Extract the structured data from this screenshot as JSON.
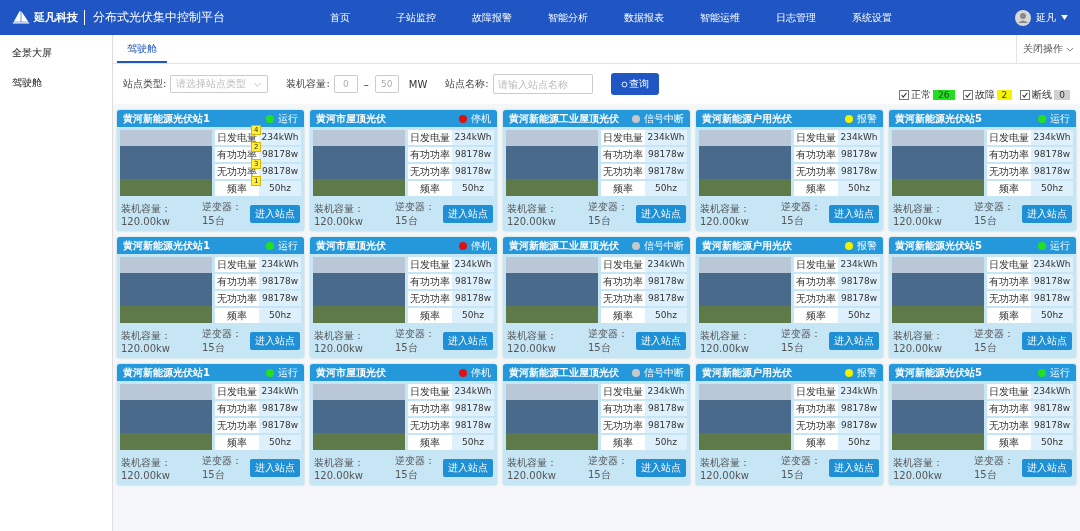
{
  "header": {
    "logo": "延凡科技",
    "title": "分布式光伏集中控制平台",
    "nav": [
      "首页",
      "子站监控",
      "故障报警",
      "智能分析",
      "数据报表",
      "智能运维",
      "日志管理",
      "系统设置"
    ],
    "user": "延凡"
  },
  "sidebar": {
    "items": [
      "全景大屏",
      "驾驶舱"
    ]
  },
  "tabs": [
    {
      "label": "驾驶舱",
      "selected": true
    }
  ],
  "close_action": "关闭操作",
  "filters": {
    "type_label": "站点类型:",
    "type_placeholder": "请选择站点类型",
    "capacity_label": "装机容量:",
    "capacity_min": "0",
    "range_sep": "–",
    "capacity_max": "50",
    "unit": "MW",
    "name_label": "站点名称:",
    "name_placeholder": "请输入站点名称",
    "query": "查询"
  },
  "legend": [
    {
      "label": "正常",
      "count": "26",
      "checked": true,
      "color": "#22e01f"
    },
    {
      "label": "故障",
      "count": "2",
      "checked": true,
      "color": "#f5f500"
    },
    {
      "label": "断线",
      "count": "0",
      "checked": true,
      "color": "#d0d0d0"
    }
  ],
  "rows": [
    {
      "cards": [
        {
          "name": "黄河新能源光伏站1",
          "status": "运行",
          "color": "#22e01f",
          "metrics": [
            {
              "label": "日发电量",
              "value": "234kWh",
              "badge": "4"
            },
            {
              "label": "有功功率",
              "value": "98178w",
              "badge": "2"
            },
            {
              "label": "无功功率",
              "value": "98178w",
              "badge": "3"
            },
            {
              "label": "频率",
              "value": "50hz",
              "badge": "1"
            }
          ],
          "capacity": "装机容量：120.00kw",
          "inverter": "逆变器：15台",
          "button": "进入站点"
        },
        {
          "name": "黄河市屋顶光伏",
          "status": "停机",
          "color": "#e01010",
          "metrics": [
            {
              "label": "日发电量",
              "value": "234kWh"
            },
            {
              "label": "有功功率",
              "value": "98178w"
            },
            {
              "label": "无功功率",
              "value": "98178w"
            },
            {
              "label": "频率",
              "value": "50hz"
            }
          ],
          "capacity": "装机容量：120.00kw",
          "inverter": "逆变器：15台",
          "button": "进入站点"
        },
        {
          "name": "黄河新能源工业屋顶光伏",
          "status": "信号中断",
          "color": "#c8c8c8",
          "metrics": [
            {
              "label": "日发电量",
              "value": "234kWh"
            },
            {
              "label": "有功功率",
              "value": "98178w"
            },
            {
              "label": "无功功率",
              "value": "98178w"
            },
            {
              "label": "频率",
              "value": "50hz"
            }
          ],
          "capacity": "装机容量：120.00kw",
          "inverter": "逆变器：15台",
          "button": "进入站点"
        },
        {
          "name": "黄河新能源户用光伏",
          "status": "报警",
          "color": "#f0f000",
          "metrics": [
            {
              "label": "日发电量",
              "value": "234kWh"
            },
            {
              "label": "有功功率",
              "value": "98178w"
            },
            {
              "label": "无功功率",
              "value": "98178w"
            },
            {
              "label": "频率",
              "value": "50hz"
            }
          ],
          "capacity": "装机容量：120.00kw",
          "inverter": "逆变器：15台",
          "button": "进入站点"
        },
        {
          "name": "黄河新能源光伏站5",
          "status": "运行",
          "color": "#22e01f",
          "metrics": [
            {
              "label": "日发电量",
              "value": "234kWh"
            },
            {
              "label": "有功功率",
              "value": "98178w"
            },
            {
              "label": "无功功率",
              "value": "98178w"
            },
            {
              "label": "频率",
              "value": "50hz"
            }
          ],
          "capacity": "装机容量：120.00kw",
          "inverter": "逆变器：15台",
          "button": "进入站点"
        }
      ]
    },
    {
      "cards": [
        {
          "name": "黄河新能源光伏站1",
          "status": "运行",
          "color": "#22e01f",
          "metrics": [
            {
              "label": "日发电量",
              "value": "234kWh"
            },
            {
              "label": "有功功率",
              "value": "98178w"
            },
            {
              "label": "无功功率",
              "value": "98178w"
            },
            {
              "label": "频率",
              "value": "50hz"
            }
          ],
          "capacity": "装机容量：120.00kw",
          "inverter": "逆变器：15台",
          "button": "进入站点"
        },
        {
          "name": "黄河市屋顶光伏",
          "status": "停机",
          "color": "#e01010",
          "metrics": [
            {
              "label": "日发电量",
              "value": "234kWh"
            },
            {
              "label": "有功功率",
              "value": "98178w"
            },
            {
              "label": "无功功率",
              "value": "98178w"
            },
            {
              "label": "频率",
              "value": "50hz"
            }
          ],
          "capacity": "装机容量：120.00kw",
          "inverter": "逆变器：15台",
          "button": "进入站点"
        },
        {
          "name": "黄河新能源工业屋顶光伏",
          "status": "信号中断",
          "color": "#c8c8c8",
          "metrics": [
            {
              "label": "日发电量",
              "value": "234kWh"
            },
            {
              "label": "有功功率",
              "value": "98178w"
            },
            {
              "label": "无功功率",
              "value": "98178w"
            },
            {
              "label": "频率",
              "value": "50hz"
            }
          ],
          "capacity": "装机容量：120.00kw",
          "inverter": "逆变器：15台",
          "button": "进入站点"
        },
        {
          "name": "黄河新能源户用光伏",
          "status": "报警",
          "color": "#f0f000",
          "metrics": [
            {
              "label": "日发电量",
              "value": "234kWh"
            },
            {
              "label": "有功功率",
              "value": "98178w"
            },
            {
              "label": "无功功率",
              "value": "98178w"
            },
            {
              "label": "频率",
              "value": "50hz"
            }
          ],
          "capacity": "装机容量：120.00kw",
          "inverter": "逆变器：15台",
          "button": "进入站点"
        },
        {
          "name": "黄河新能源光伏站5",
          "status": "运行",
          "color": "#22e01f",
          "metrics": [
            {
              "label": "日发电量",
              "value": "234kWh"
            },
            {
              "label": "有功功率",
              "value": "98178w"
            },
            {
              "label": "无功功率",
              "value": "98178w"
            },
            {
              "label": "频率",
              "value": "50hz"
            }
          ],
          "capacity": "装机容量：120.00kw",
          "inverter": "逆变器：15台",
          "button": "进入站点"
        }
      ]
    },
    {
      "cards": [
        {
          "name": "黄河新能源光伏站1",
          "status": "运行",
          "color": "#22e01f",
          "metrics": [
            {
              "label": "日发电量",
              "value": "234kWh"
            },
            {
              "label": "有功功率",
              "value": "98178w"
            },
            {
              "label": "无功功率",
              "value": "98178w"
            },
            {
              "label": "频率",
              "value": "50hz"
            }
          ],
          "capacity": "装机容量：120.00kw",
          "inverter": "逆变器：15台",
          "button": "进入站点"
        },
        {
          "name": "黄河市屋顶光伏",
          "status": "停机",
          "color": "#e01010",
          "metrics": [
            {
              "label": "日发电量",
              "value": "234kWh"
            },
            {
              "label": "有功功率",
              "value": "98178w"
            },
            {
              "label": "无功功率",
              "value": "98178w"
            },
            {
              "label": "频率",
              "value": "50hz"
            }
          ],
          "capacity": "装机容量：120.00kw",
          "inverter": "逆变器：15台",
          "button": "进入站点"
        },
        {
          "name": "黄河新能源工业屋顶光伏",
          "status": "信号中断",
          "color": "#c8c8c8",
          "metrics": [
            {
              "label": "日发电量",
              "value": "234kWh"
            },
            {
              "label": "有功功率",
              "value": "98178w"
            },
            {
              "label": "无功功率",
              "value": "98178w"
            },
            {
              "label": "频率",
              "value": "50hz"
            }
          ],
          "capacity": "装机容量：120.00kw",
          "inverter": "逆变器：15台",
          "button": "进入站点"
        },
        {
          "name": "黄河新能源户用光伏",
          "status": "报警",
          "color": "#f0f000",
          "metrics": [
            {
              "label": "日发电量",
              "value": "234kWh"
            },
            {
              "label": "有功功率",
              "value": "98178w"
            },
            {
              "label": "无功功率",
              "value": "98178w"
            },
            {
              "label": "频率",
              "value": "50hz"
            }
          ],
          "capacity": "装机容量：120.00kw",
          "inverter": "逆变器：15台",
          "button": "进入站点"
        },
        {
          "name": "黄河新能源光伏站5",
          "status": "运行",
          "color": "#22e01f",
          "metrics": [
            {
              "label": "日发电量",
              "value": "234kWh"
            },
            {
              "label": "有功功率",
              "value": "98178w"
            },
            {
              "label": "无功功率",
              "value": "98178w"
            },
            {
              "label": "频率",
              "value": "50hz"
            }
          ],
          "capacity": "装机容量：120.00kw",
          "inverter": "逆变器：15台",
          "button": "进入站点"
        }
      ]
    }
  ]
}
